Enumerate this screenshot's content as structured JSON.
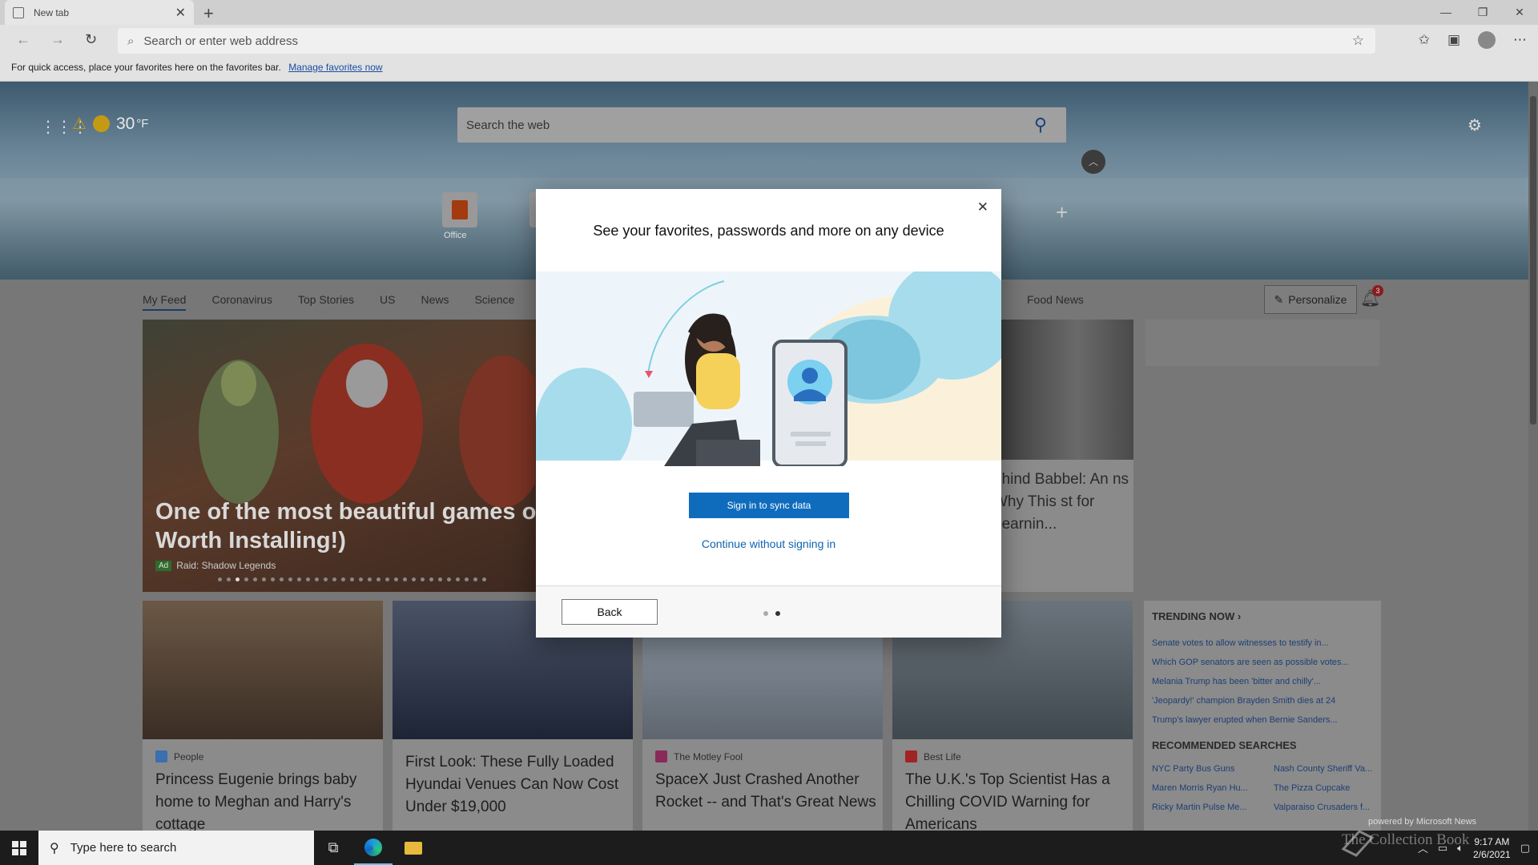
{
  "browser": {
    "tab_title": "New tab",
    "tab_close": "✕",
    "new_tab": "+",
    "window_controls": [
      "—",
      "❐",
      "✕"
    ],
    "address_placeholder": "Search or enter web address",
    "favorites_bar_text": "For quick access, place your favorites here on the favorites bar.",
    "favorites_bar_link": "Manage favorites now"
  },
  "newtab": {
    "weather_temp": "30",
    "weather_unit": "°F",
    "search_placeholder": "Search the web",
    "quick_link_label": "Office",
    "feed_tabs": [
      "My Feed",
      "Coronavirus",
      "Top Stories",
      "US",
      "News",
      "Science"
    ],
    "feed_tab_right": "Food News",
    "personalize": "Personalize",
    "notification_count": "3",
    "hero_card": {
      "title": "One of the most beautiful games of 2",
      "title_line2": "Worth Installing!)",
      "ad_badge": "Ad",
      "source": "Raid: Shadow Legends"
    },
    "right_card_title": "ehind Babbel: An ns Why This st for Learnin...",
    "cards": [
      {
        "source": "People",
        "title": "Princess Eugenie brings baby home to Meghan and Harry's cottage",
        "logo_color": "#3a6fb0",
        "image_color": "#5a4a3a"
      },
      {
        "source": "",
        "title": "First Look: These Fully Loaded Hyundai Venues Can Now Cost Under $19,000",
        "logo_color": "#999999",
        "image_color": "#2b3650"
      },
      {
        "source": "The Motley Fool",
        "title": "SpaceX Just Crashed Another Rocket -- and That's Great News",
        "logo_color": "#8a2a5a",
        "image_color": "#7f8b97"
      },
      {
        "source": "Best Life",
        "title": "The U.K.'s Top Scientist Has a Chilling COVID Warning for Americans",
        "logo_color": "#a02424",
        "image_color": "#5b6670"
      }
    ],
    "trending": {
      "title": "TRENDING NOW",
      "items": [
        "Senate votes to allow witnesses to testify in...",
        "Which GOP senators are seen as possible votes...",
        "Melania Trump has been 'bitter and chilly'...",
        "'Jeopardy!' champion Brayden Smith dies at 24",
        "Trump's lawyer erupted when Bernie Sanders..."
      ],
      "recommended_title": "RECOMMENDED SEARCHES",
      "recommended": [
        "NYC Party Bus Guns",
        "Nash County Sheriff Va...",
        "Maren Morris Ryan Hu...",
        "The Pizza Cupcake",
        "Ricky Martin Pulse Me...",
        "Valparaiso Crusaders f..."
      ],
      "powered_by": "powered by Microsoft News"
    }
  },
  "modal": {
    "title": "See your favorites, passwords and more on any device",
    "close": "✕",
    "primary_button": "Sign in to sync data",
    "secondary_link": "Continue without signing in",
    "back_button": "Back",
    "step_total": 2,
    "step_current": 2
  },
  "taskbar": {
    "search_placeholder": "Type here to search",
    "clock_time": "9:17 AM",
    "clock_date": "2/6/2021",
    "watermark": "The Collection Book"
  },
  "colors": {
    "accent": "#0f6cbd",
    "link": "#0f63b3"
  }
}
